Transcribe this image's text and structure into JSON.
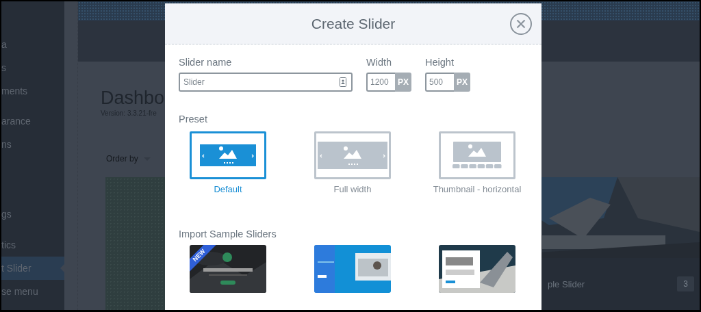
{
  "sidebar": {
    "items": [
      {
        "label": "a",
        "selected": false
      },
      {
        "label": "s",
        "selected": false
      },
      {
        "label": "ments",
        "selected": false
      },
      {
        "label": "arance",
        "selected": false
      },
      {
        "label": "ns",
        "selected": false
      },
      {
        "label": "gs",
        "selected": false
      },
      {
        "label": "tics",
        "selected": false
      },
      {
        "label": "t Slider",
        "selected": true
      },
      {
        "label": "se menu",
        "selected": false
      }
    ]
  },
  "page": {
    "title": "Dashbo",
    "version": "Version: 3.3.21-fre",
    "order_by": "Order by",
    "slider_card": {
      "label": "ple Slider",
      "count": "3"
    }
  },
  "modal": {
    "title": "Create Slider",
    "fields": [
      {
        "kind": "name",
        "label": "Slider name",
        "value": "Slider"
      },
      {
        "kind": "size",
        "label": "Width",
        "value": "1200",
        "unit": "PX"
      },
      {
        "kind": "size",
        "label": "Height",
        "value": "500",
        "unit": "PX"
      }
    ],
    "preset_heading": "Preset",
    "presets": [
      {
        "kind": "default",
        "label": "Default",
        "selected": true
      },
      {
        "kind": "full_width",
        "label": "Full width",
        "selected": false
      },
      {
        "kind": "thumbnail_horizontal",
        "label": "Thumbnail - horizontal",
        "selected": false
      }
    ],
    "samples_heading": "Import Sample Sliders",
    "samples": [
      {
        "kind": "picture",
        "badge": "NEW"
      },
      {
        "kind": "picture"
      },
      {
        "kind": "picture"
      }
    ]
  }
}
